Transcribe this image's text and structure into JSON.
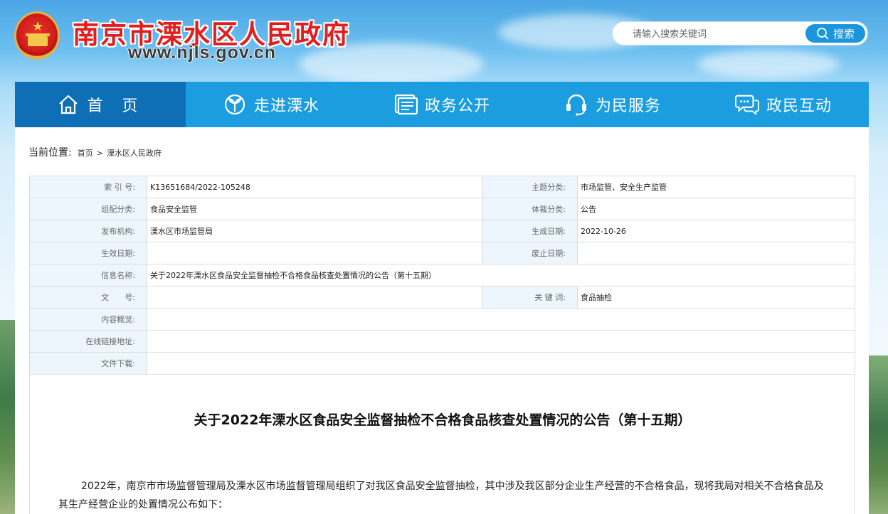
{
  "header": {
    "site_title": "南京市溧水区人民政府",
    "site_url": "www.njls.gov.cn",
    "search": {
      "placeholder": "请输入搜索关键词",
      "button_label": "搜索"
    }
  },
  "nav": {
    "items": [
      {
        "label": "首 页",
        "icon": "home-icon",
        "active": true
      },
      {
        "label": "走进溧水",
        "icon": "sprout-icon",
        "active": false
      },
      {
        "label": "政务公开",
        "icon": "document-icon",
        "active": false
      },
      {
        "label": "为民服务",
        "icon": "headset-icon",
        "active": false
      },
      {
        "label": "政民互动",
        "icon": "chat-icon",
        "active": false
      }
    ]
  },
  "breadcrumb": {
    "label": "当前位置:",
    "items": [
      "首页",
      "溧水区人民政府"
    ],
    "separator": ">"
  },
  "meta": {
    "index_no_label": "索 引 号:",
    "index_no": "K13651684/2022-105248",
    "topic_label": "主题分类:",
    "topic": "市场监管、安全生产监管",
    "group_label": "组配分类:",
    "group": "食品安全监管",
    "genre_label": "体裁分类:",
    "genre": "公告",
    "publisher_label": "发布机构:",
    "publisher": "溧水区市场监管局",
    "created_label": "生成日期:",
    "created": "2022-10-26",
    "effective_label": "生效日期:",
    "effective": "",
    "abolished_label": "废止日期:",
    "abolished": "",
    "name_label": "信息名称:",
    "name": "关于2022年溧水区食品安全监督抽检不合格食品核查处置情况的公告（第十五期）",
    "docno_label": "文　　号:",
    "docno": "",
    "keywords_label": "关 键 词:",
    "keywords": "食品抽检",
    "summary_label": "内容概览:",
    "summary": "",
    "link_label": "在线链接地址:",
    "link": "",
    "download_label": "文件下载:",
    "download": ""
  },
  "document": {
    "title": "关于2022年溧水区食品安全监督抽检不合格食品核查处置情况的公告（第十五期）",
    "body": "2022年，南京市市场监督管理局及溧水区市场监督管理局组织了对我区食品安全监督抽检，其中涉及我区部分企业生产经营的不合格食品，现将我局对相关不合格食品及其生产经营企业的处置情况公布如下："
  },
  "colors": {
    "nav_bg": "#1b9de0",
    "nav_active": "#0e6fb7",
    "title_red": "#e11e1e",
    "label_bg": "#eef6fd"
  }
}
